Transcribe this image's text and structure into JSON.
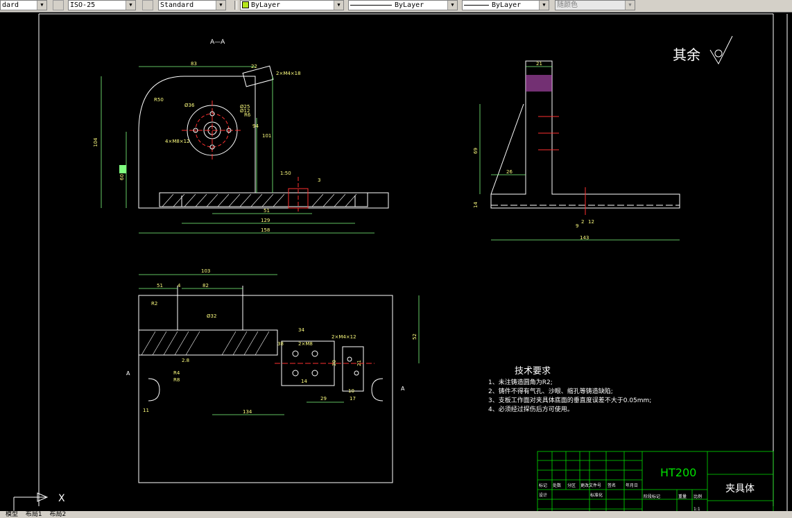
{
  "toolbar": {
    "text_style": "dard",
    "dim_style": "ISO-25",
    "table_style": "Standard",
    "layer": "ByLayer",
    "linetype": "ByLayer",
    "lineweight": "ByLayer",
    "plot_style": "随颜色",
    "layer_color": "#b5e61d"
  },
  "drawing": {
    "section_label": "A—A",
    "roughness_note": "其余",
    "section_mark_left": "A",
    "section_mark_right": "A",
    "dims_front": [
      "83",
      "22",
      "R50",
      "Ø36",
      "Ø25",
      "Ø12",
      "R6",
      "94",
      "101",
      "104",
      "60",
      "4×M8×12",
      "2×M4×18",
      "51",
      "129",
      "158",
      "3",
      "1:50"
    ],
    "dims_side": [
      "21",
      "69",
      "26",
      "14",
      "143",
      "9",
      "2",
      "12"
    ],
    "dims_top": [
      "103",
      "51",
      "4",
      "82",
      "R2",
      "Ø32",
      "34",
      "2×M8",
      "2×M4×12",
      "52",
      "38",
      "30",
      "21",
      "14",
      "10",
      "29",
      "17",
      "134",
      "11",
      "R4",
      "R8",
      "2.8"
    ],
    "tech_title": "技术要求",
    "tech_notes": [
      "1、未注铸造圆角为R2;",
      "2、铸件不得有气孔、沙眼、缩孔等铸造缺陷;",
      "3、支板工作面对夹具体底面的垂直度误差不大于0.05mm;",
      "4、必须经过探伤后方可使用。"
    ]
  },
  "title_block": {
    "material": "HT200",
    "part_name": "夹具体",
    "sheet": "A2",
    "scale": "1:1",
    "row_labels": [
      "标记",
      "处数",
      "分区",
      "更改文件号",
      "签名",
      "年月日"
    ],
    "design": "设计",
    "standard": "标准化",
    "review": "审核",
    "process": "工艺",
    "approve": "批准",
    "stage_labels": [
      "阶段标记",
      "重量",
      "比例"
    ]
  },
  "ucs": {
    "x_label": "X"
  },
  "tabs": [
    "模型",
    "布局1",
    "布局2"
  ]
}
